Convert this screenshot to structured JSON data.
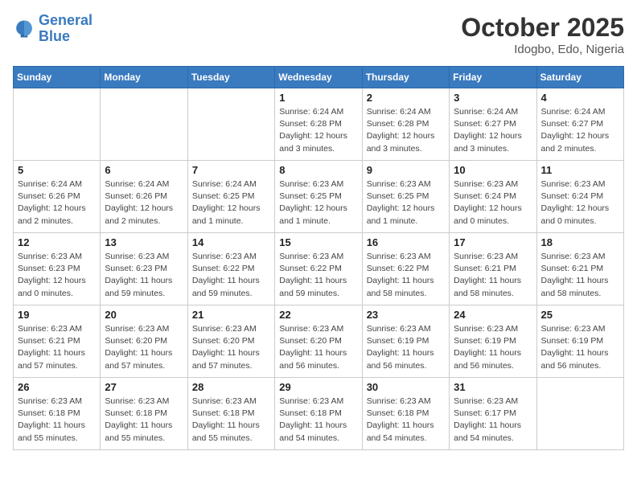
{
  "header": {
    "logo_general": "General",
    "logo_blue": "Blue",
    "month_year": "October 2025",
    "location": "Idogbo, Edo, Nigeria"
  },
  "days_of_week": [
    "Sunday",
    "Monday",
    "Tuesday",
    "Wednesday",
    "Thursday",
    "Friday",
    "Saturday"
  ],
  "weeks": [
    [
      {
        "day": "",
        "info": ""
      },
      {
        "day": "",
        "info": ""
      },
      {
        "day": "",
        "info": ""
      },
      {
        "day": "1",
        "info": "Sunrise: 6:24 AM\nSunset: 6:28 PM\nDaylight: 12 hours\nand 3 minutes."
      },
      {
        "day": "2",
        "info": "Sunrise: 6:24 AM\nSunset: 6:28 PM\nDaylight: 12 hours\nand 3 minutes."
      },
      {
        "day": "3",
        "info": "Sunrise: 6:24 AM\nSunset: 6:27 PM\nDaylight: 12 hours\nand 3 minutes."
      },
      {
        "day": "4",
        "info": "Sunrise: 6:24 AM\nSunset: 6:27 PM\nDaylight: 12 hours\nand 2 minutes."
      }
    ],
    [
      {
        "day": "5",
        "info": "Sunrise: 6:24 AM\nSunset: 6:26 PM\nDaylight: 12 hours\nand 2 minutes."
      },
      {
        "day": "6",
        "info": "Sunrise: 6:24 AM\nSunset: 6:26 PM\nDaylight: 12 hours\nand 2 minutes."
      },
      {
        "day": "7",
        "info": "Sunrise: 6:24 AM\nSunset: 6:25 PM\nDaylight: 12 hours\nand 1 minute."
      },
      {
        "day": "8",
        "info": "Sunrise: 6:23 AM\nSunset: 6:25 PM\nDaylight: 12 hours\nand 1 minute."
      },
      {
        "day": "9",
        "info": "Sunrise: 6:23 AM\nSunset: 6:25 PM\nDaylight: 12 hours\nand 1 minute."
      },
      {
        "day": "10",
        "info": "Sunrise: 6:23 AM\nSunset: 6:24 PM\nDaylight: 12 hours\nand 0 minutes."
      },
      {
        "day": "11",
        "info": "Sunrise: 6:23 AM\nSunset: 6:24 PM\nDaylight: 12 hours\nand 0 minutes."
      }
    ],
    [
      {
        "day": "12",
        "info": "Sunrise: 6:23 AM\nSunset: 6:23 PM\nDaylight: 12 hours\nand 0 minutes."
      },
      {
        "day": "13",
        "info": "Sunrise: 6:23 AM\nSunset: 6:23 PM\nDaylight: 11 hours\nand 59 minutes."
      },
      {
        "day": "14",
        "info": "Sunrise: 6:23 AM\nSunset: 6:22 PM\nDaylight: 11 hours\nand 59 minutes."
      },
      {
        "day": "15",
        "info": "Sunrise: 6:23 AM\nSunset: 6:22 PM\nDaylight: 11 hours\nand 59 minutes."
      },
      {
        "day": "16",
        "info": "Sunrise: 6:23 AM\nSunset: 6:22 PM\nDaylight: 11 hours\nand 58 minutes."
      },
      {
        "day": "17",
        "info": "Sunrise: 6:23 AM\nSunset: 6:21 PM\nDaylight: 11 hours\nand 58 minutes."
      },
      {
        "day": "18",
        "info": "Sunrise: 6:23 AM\nSunset: 6:21 PM\nDaylight: 11 hours\nand 58 minutes."
      }
    ],
    [
      {
        "day": "19",
        "info": "Sunrise: 6:23 AM\nSunset: 6:21 PM\nDaylight: 11 hours\nand 57 minutes."
      },
      {
        "day": "20",
        "info": "Sunrise: 6:23 AM\nSunset: 6:20 PM\nDaylight: 11 hours\nand 57 minutes."
      },
      {
        "day": "21",
        "info": "Sunrise: 6:23 AM\nSunset: 6:20 PM\nDaylight: 11 hours\nand 57 minutes."
      },
      {
        "day": "22",
        "info": "Sunrise: 6:23 AM\nSunset: 6:20 PM\nDaylight: 11 hours\nand 56 minutes."
      },
      {
        "day": "23",
        "info": "Sunrise: 6:23 AM\nSunset: 6:19 PM\nDaylight: 11 hours\nand 56 minutes."
      },
      {
        "day": "24",
        "info": "Sunrise: 6:23 AM\nSunset: 6:19 PM\nDaylight: 11 hours\nand 56 minutes."
      },
      {
        "day": "25",
        "info": "Sunrise: 6:23 AM\nSunset: 6:19 PM\nDaylight: 11 hours\nand 56 minutes."
      }
    ],
    [
      {
        "day": "26",
        "info": "Sunrise: 6:23 AM\nSunset: 6:18 PM\nDaylight: 11 hours\nand 55 minutes."
      },
      {
        "day": "27",
        "info": "Sunrise: 6:23 AM\nSunset: 6:18 PM\nDaylight: 11 hours\nand 55 minutes."
      },
      {
        "day": "28",
        "info": "Sunrise: 6:23 AM\nSunset: 6:18 PM\nDaylight: 11 hours\nand 55 minutes."
      },
      {
        "day": "29",
        "info": "Sunrise: 6:23 AM\nSunset: 6:18 PM\nDaylight: 11 hours\nand 54 minutes."
      },
      {
        "day": "30",
        "info": "Sunrise: 6:23 AM\nSunset: 6:18 PM\nDaylight: 11 hours\nand 54 minutes."
      },
      {
        "day": "31",
        "info": "Sunrise: 6:23 AM\nSunset: 6:17 PM\nDaylight: 11 hours\nand 54 minutes."
      },
      {
        "day": "",
        "info": ""
      }
    ]
  ]
}
